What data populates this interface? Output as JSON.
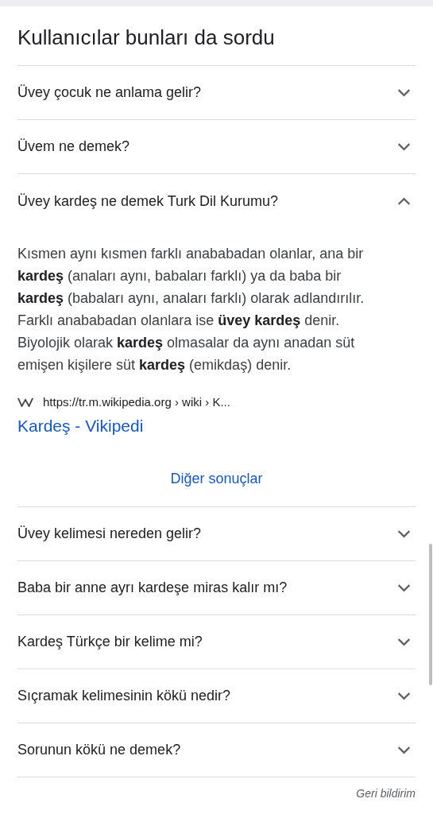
{
  "heading": "Kullanıcılar bunları da sordu",
  "questions": [
    {
      "text": "Üvey çocuk ne anlama gelir?",
      "expanded": false
    },
    {
      "text": "Üvem ne demek?",
      "expanded": false
    },
    {
      "text": "Üvey kardeş ne demek Turk Dil Kurumu?",
      "expanded": true,
      "answer": {
        "text": "Kısmen aynı kısmen farklı anababadan olanlar, ana bir **kardeş** (anaları aynı, babaları farklı) ya da baba bir **kardeş** (babaları aynı, anaları farklı) olarak adlandırılır. Farklı anababadan olanlara ise **üvey kardeş** denir. Biyolojik olarak **kardeş** olmasalar da aynı anadan süt emişen kişilere süt **kardeş** (emikdaş) denir.",
        "source_url": "https://tr.m.wikipedia.org › wiki › K...",
        "source_title": "Kardeş - Vikipedi"
      }
    }
  ],
  "more_button": "Diğer sonuçlar",
  "more_questions": [
    {
      "text": "Üvey kelimesi nereden gelir?",
      "expanded": false
    },
    {
      "text": "Baba bir anne ayrı kardeşe miras kalır mı?",
      "expanded": false
    },
    {
      "text": "Kardeş Türkçe bir kelime mi?",
      "expanded": false
    },
    {
      "text": "Sıçramak kelimesinin kökü nedir?",
      "expanded": false
    },
    {
      "text": "Sorunun kökü ne demek?",
      "expanded": false
    }
  ],
  "feedback": "Geri bildirim"
}
